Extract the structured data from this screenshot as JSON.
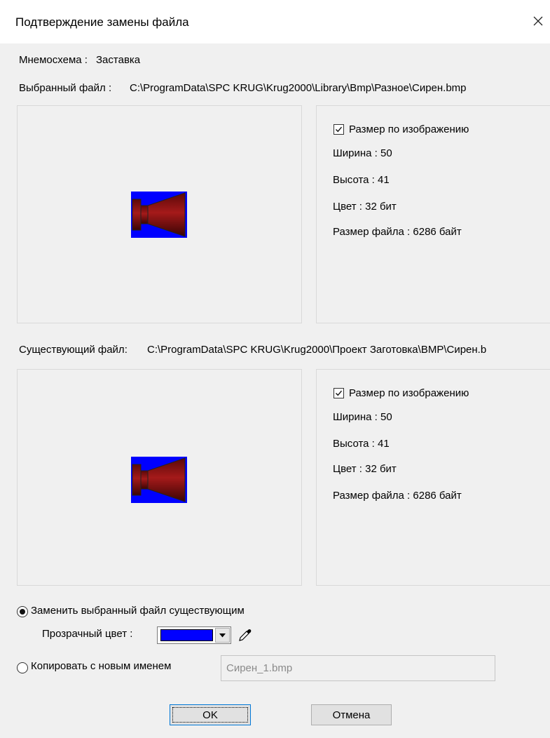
{
  "window": {
    "title": "Подтверждение замены файла"
  },
  "mnemo": {
    "label": "Мнемосхема :",
    "value": "Заставка"
  },
  "selected_file": {
    "label": "Выбранный файл :",
    "path": "C:\\ProgramData\\SPC KRUG\\Krug2000\\Library\\Bmp\\Разное\\Сирен.bmp",
    "checkbox_label": "Размер по изображению",
    "checked": true,
    "width": "Ширина : 50",
    "height": "Высота : 41",
    "color": "Цвет : 32 бит",
    "file_size": "Размер файла : 6286 байт"
  },
  "existing_file": {
    "label": "Существующий файл:",
    "path": "C:\\ProgramData\\SPC KRUG\\Krug2000\\Проект Заготовка\\BMP\\Сирен.b",
    "checkbox_label": "Размер по изображению",
    "checked": true,
    "width": "Ширина : 50",
    "height": "Высота : 41",
    "color": "Цвет : 32 бит",
    "file_size": "Размер файла : 6286 байт"
  },
  "options": {
    "replace_label": "Заменить выбранный файл существующим",
    "transparent_label": "Прозрачный цвет :",
    "transparent_color": "#0000ff",
    "copy_label": "Копировать с новым именем",
    "new_name": "Сирен_1.bmp",
    "selected": "replace"
  },
  "buttons": {
    "ok": "OK",
    "cancel": "Отмена"
  },
  "colors": {
    "siren_body": "#8b1010",
    "siren_background": "#0000ff"
  }
}
